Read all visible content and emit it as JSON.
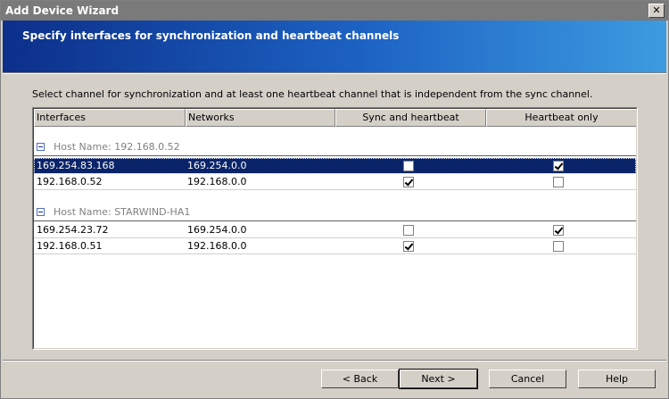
{
  "window": {
    "title": "Add Device Wizard",
    "close_symbol": "✕"
  },
  "banner": {
    "heading": "Specify interfaces for synchronization and heartbeat channels"
  },
  "instruction": "Select channel for synchronization and at least one heartbeat channel that is independent from the sync channel.",
  "columns": [
    "Interfaces",
    "Networks",
    "Sync and heartbeat",
    "Heartbeat only"
  ],
  "groups": [
    {
      "label": "Host Name: 192.168.0.52",
      "rows": [
        {
          "interface": "169.254.83.168",
          "network": "169.254.0.0",
          "sync": false,
          "heartbeat": true,
          "selected": true
        },
        {
          "interface": "192.168.0.52",
          "network": "192.168.0.0",
          "sync": true,
          "heartbeat": false,
          "selected": false
        }
      ]
    },
    {
      "label": "Host Name: STARWIND-HA1",
      "rows": [
        {
          "interface": "169.254.23.72",
          "network": "169.254.0.0",
          "sync": false,
          "heartbeat": true,
          "selected": false
        },
        {
          "interface": "192.168.0.51",
          "network": "192.168.0.0",
          "sync": true,
          "heartbeat": false,
          "selected": false
        }
      ]
    }
  ],
  "buttons": {
    "back": "< Back",
    "next": "Next >",
    "cancel": "Cancel",
    "help": "Help"
  }
}
